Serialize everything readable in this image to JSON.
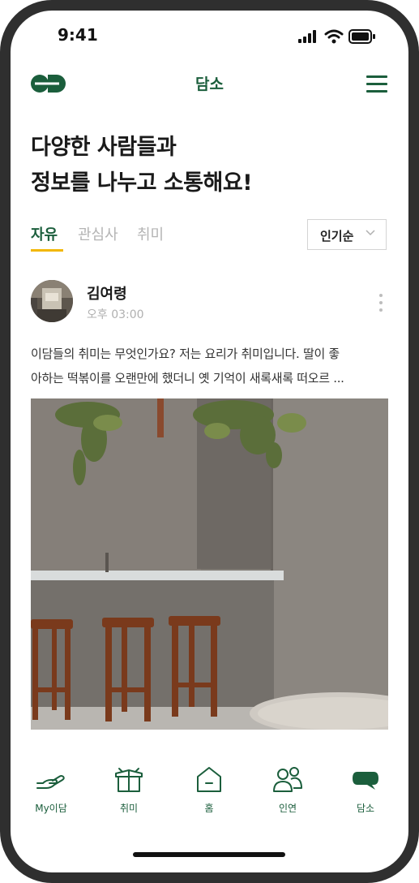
{
  "status_bar": {
    "time": "9:41"
  },
  "header": {
    "title": "담소"
  },
  "hero": {
    "line1": "다양한 사람들과",
    "line2": "정보를 나누고 소통해요!"
  },
  "tabs": [
    {
      "label": "자유",
      "active": true
    },
    {
      "label": "관심사",
      "active": false
    },
    {
      "label": "취미",
      "active": false
    }
  ],
  "sort": {
    "selected": "인기순"
  },
  "post": {
    "author": "김여령",
    "time": "오후 03:00",
    "body_line1": "이담들의 취미는 무엇인가요? 저는 요리가 취미입니다. 딸이 좋",
    "body_line2": "아하는 떡볶이를 오랜만에 했더니 옛 기억이 새록새록 떠오르 ..."
  },
  "bottom_nav": [
    {
      "label": "My이담",
      "icon": "hand-heart-icon"
    },
    {
      "label": "취미",
      "icon": "box-icon"
    },
    {
      "label": "홈",
      "icon": "home-icon"
    },
    {
      "label": "인연",
      "icon": "people-icon"
    },
    {
      "label": "담소",
      "icon": "chat-bubble-icon"
    }
  ],
  "colors": {
    "primary": "#1b5e3c",
    "accent": "#f2b705",
    "inactive_tab": "#b4b4b4"
  }
}
